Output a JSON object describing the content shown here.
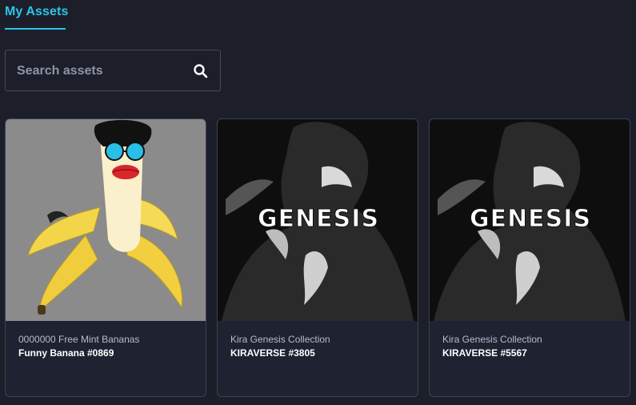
{
  "tabs": {
    "my_assets": "My Assets"
  },
  "search": {
    "placeholder": "Search assets",
    "value": ""
  },
  "assets": [
    {
      "collection": "0000000 Free Mint Bananas",
      "name": "Funny Banana #0869",
      "image": "banana-character"
    },
    {
      "collection": "Kira Genesis Collection",
      "name": "KIRAVERSE #3805",
      "image": "genesis-artwork",
      "image_text": "GENESIS"
    },
    {
      "collection": "Kira Genesis Collection",
      "name": "KIRAVERSE #5567",
      "image": "genesis-artwork",
      "image_text": "GENESIS"
    }
  ],
  "colors": {
    "background": "#1c1f2a",
    "accent": "#2ec4e8",
    "card_border": "#3d424f"
  }
}
